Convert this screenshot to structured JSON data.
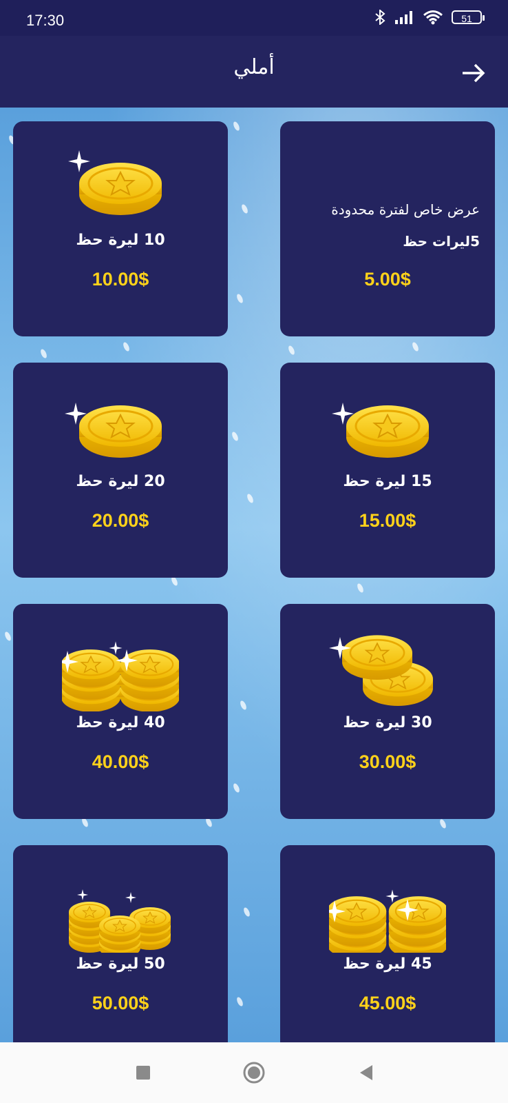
{
  "status_bar": {
    "time": "17:30",
    "battery": "51",
    "icons": [
      "bluetooth-icon",
      "signal-icon",
      "wifi-icon",
      "battery-icon"
    ]
  },
  "header": {
    "title": "أملي",
    "back_icon": "arrow-right-icon"
  },
  "colors": {
    "card_bg": "#24245f",
    "header_bg": "#24245f",
    "price": "#ffd21a",
    "status_bg": "#1f1f5a"
  },
  "packages": [
    {
      "id": "offer",
      "line1": "عرض  خاص لفترة محدودة",
      "line2": "5ليرات حظ",
      "price": "5.00$"
    },
    {
      "id": "p10",
      "name": "10 ليرة حظ",
      "price": "10.00$",
      "icon": "single-coin-icon"
    },
    {
      "id": "p15",
      "name": "15 ليرة حظ",
      "price": "15.00$",
      "icon": "single-coin-icon"
    },
    {
      "id": "p20",
      "name": "20 ليرة حظ",
      "price": "20.00$",
      "icon": "single-coin-icon"
    },
    {
      "id": "p30",
      "name": "30 ليرة حظ",
      "price": "30.00$",
      "icon": "two-coins-icon"
    },
    {
      "id": "p40",
      "name": "40 ليرة حظ",
      "price": "40.00$",
      "icon": "coin-stacks-icon"
    },
    {
      "id": "p45",
      "name": "45 ليرة حظ",
      "price": "45.00$",
      "icon": "coin-stacks-icon"
    },
    {
      "id": "p50",
      "name": "50 ليرة حظ",
      "price": "50.00$",
      "icon": "coin-pile-icon"
    }
  ],
  "nav_bar": {
    "icons": [
      "recents-square-icon",
      "home-circle-icon",
      "back-triangle-icon"
    ]
  }
}
